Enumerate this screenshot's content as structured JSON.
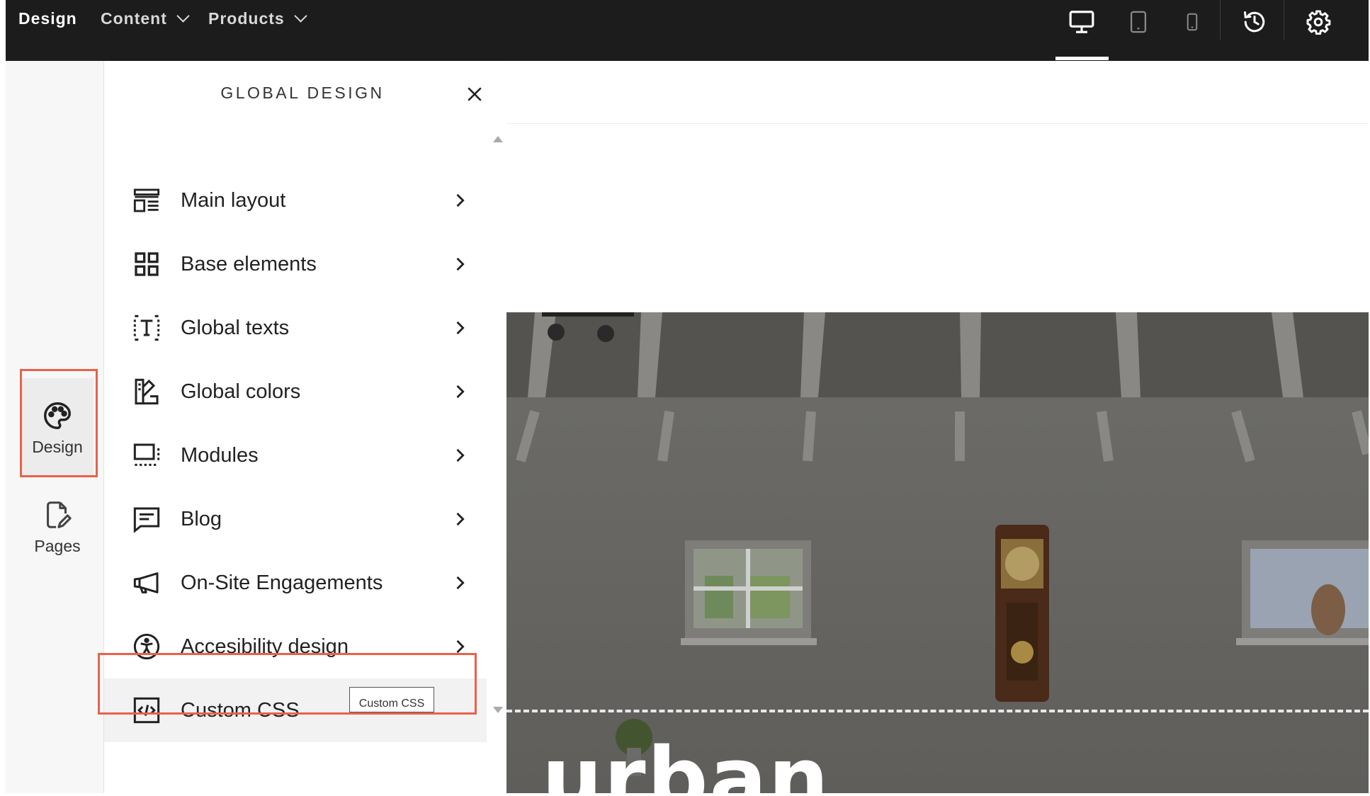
{
  "topbar": {
    "nav": [
      {
        "label": "Design",
        "active": true
      },
      {
        "label": "Content",
        "dropdown": true
      },
      {
        "label": "Products",
        "dropdown": true
      }
    ],
    "icons": [
      "desktop-icon",
      "tablet-icon",
      "mobile-icon",
      "history-icon",
      "settings-icon"
    ],
    "selected_device": "desktop"
  },
  "rail": {
    "items": [
      {
        "label": "Design",
        "icon": "palette-icon",
        "selected": true
      },
      {
        "label": "Pages",
        "icon": "page-edit-icon",
        "selected": false
      }
    ]
  },
  "panel": {
    "title": "GLOBAL DESIGN",
    "items": [
      {
        "label": "Main layout",
        "icon": "layout-icon"
      },
      {
        "label": "Base elements",
        "icon": "grid-icon"
      },
      {
        "label": "Global texts",
        "icon": "text-icon"
      },
      {
        "label": "Global colors",
        "icon": "colors-icon"
      },
      {
        "label": "Modules",
        "icon": "modules-icon"
      },
      {
        "label": "Blog",
        "icon": "blog-icon"
      },
      {
        "label": "On-Site Engagements",
        "icon": "megaphone-icon"
      },
      {
        "label": "Accesibility design",
        "icon": "accessibility-icon"
      },
      {
        "label": "Custom CSS",
        "icon": "code-icon"
      }
    ],
    "tooltip": "Custom CSS"
  },
  "preview": {
    "hero_text": "urban"
  },
  "colors": {
    "topbar": "#1c1c1c",
    "highlight": "#e8624a",
    "panel_bg": "#ffffff"
  }
}
